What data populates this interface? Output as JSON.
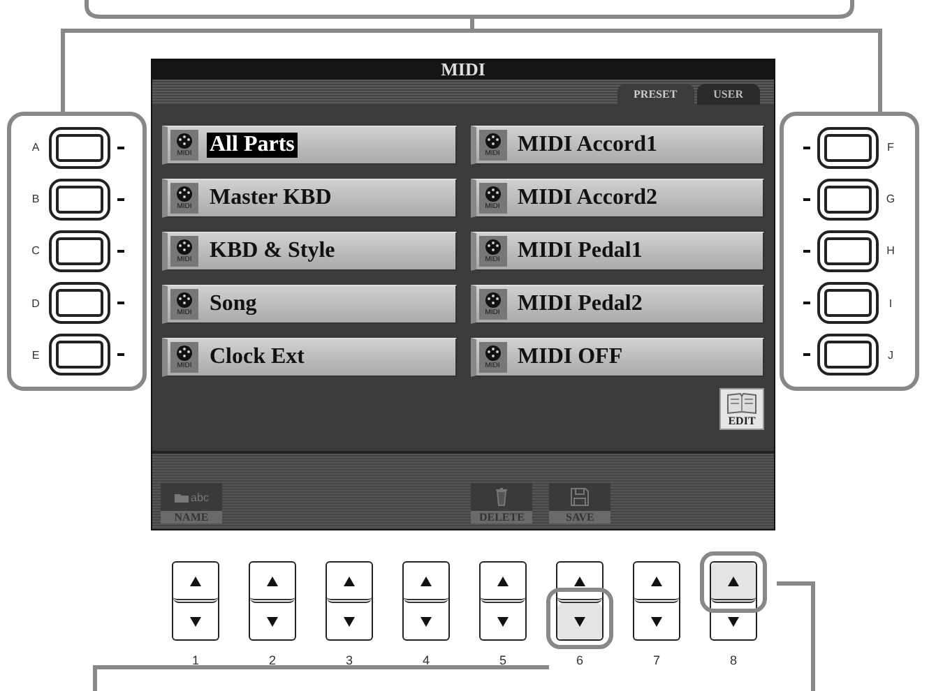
{
  "screen": {
    "title": "MIDI",
    "tabs": [
      {
        "label": "PRESET",
        "selected": true
      },
      {
        "label": "USER",
        "selected": false
      }
    ],
    "items": [
      {
        "label": "All Parts",
        "icon_text": "MIDI",
        "selected": true
      },
      {
        "label": "Master KBD",
        "icon_text": "MIDI",
        "selected": false
      },
      {
        "label": "KBD & Style",
        "icon_text": "MIDI",
        "selected": false
      },
      {
        "label": "Song",
        "icon_text": "MIDI",
        "selected": false
      },
      {
        "label": "Clock Ext",
        "icon_text": "MIDI",
        "selected": false
      },
      {
        "label": "MIDI Accord1",
        "icon_text": "MIDI",
        "selected": false
      },
      {
        "label": "MIDI Accord2",
        "icon_text": "MIDI",
        "selected": false
      },
      {
        "label": "MIDI Pedal1",
        "icon_text": "MIDI",
        "selected": false
      },
      {
        "label": "MIDI Pedal2",
        "icon_text": "MIDI",
        "selected": false
      },
      {
        "label": "MIDI OFF",
        "icon_text": "MIDI",
        "selected": false
      }
    ],
    "edit_button": {
      "label": "EDIT"
    },
    "bottom_bar": [
      {
        "kind": "name",
        "label": "NAME",
        "icon_text": "abc"
      },
      {
        "kind": "empty"
      },
      {
        "kind": "empty"
      },
      {
        "kind": "empty"
      },
      {
        "kind": "delete",
        "label": "DELETE"
      },
      {
        "kind": "save",
        "label": "SAVE"
      },
      {
        "kind": "empty"
      },
      {
        "kind": "empty"
      }
    ]
  },
  "left_buttons": [
    "A",
    "B",
    "C",
    "D",
    "E"
  ],
  "right_buttons": [
    "F",
    "G",
    "H",
    "I",
    "J"
  ],
  "number_buttons": [
    {
      "label": "1",
      "up_highlighted": false,
      "down_highlighted": false
    },
    {
      "label": "2",
      "up_highlighted": false,
      "down_highlighted": false
    },
    {
      "label": "3",
      "up_highlighted": false,
      "down_highlighted": false
    },
    {
      "label": "4",
      "up_highlighted": false,
      "down_highlighted": false
    },
    {
      "label": "5",
      "up_highlighted": false,
      "down_highlighted": false
    },
    {
      "label": "6",
      "up_highlighted": false,
      "down_highlighted": true
    },
    {
      "label": "7",
      "up_highlighted": false,
      "down_highlighted": false
    },
    {
      "label": "8",
      "up_highlighted": true,
      "down_highlighted": false
    }
  ]
}
